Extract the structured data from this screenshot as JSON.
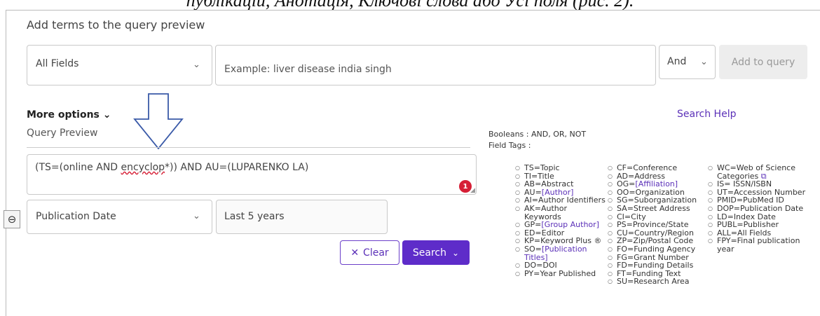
{
  "caption": "публікацій, Анотація, Ключові слова або Усі поля (рис. 2).",
  "header": {
    "title": "Add terms to the query preview"
  },
  "search_row": {
    "field_select": "All Fields",
    "input_placeholder": "Example: liver disease india singh",
    "operator_select": "And",
    "add_button": "Add to query"
  },
  "more_options": "More options",
  "query_preview": {
    "label": "Query Preview",
    "query_parts": [
      "(TS=(online AND ",
      "encyclop",
      "*)) AND AU=(LUPARENKO LA)"
    ],
    "badge_count": "1"
  },
  "filter_row": {
    "field": "Publication Date",
    "value": "Last 5 years"
  },
  "actions": {
    "clear": "Clear",
    "search": "Search"
  },
  "help_link": "Search Help",
  "booleans_text": "Booleans : AND, OR, NOT",
  "field_tags_label": "Field Tags :",
  "tags": {
    "col1": [
      {
        "text": "TS=Topic"
      },
      {
        "text": "TI=Title"
      },
      {
        "text": "AB=Abstract"
      },
      {
        "pre": "AU=",
        "link": "[Author]"
      },
      {
        "text": "AI=Author Identifiers"
      },
      {
        "text": "AK=Author Keywords"
      },
      {
        "pre": "GP=",
        "link": "[Group Author]"
      },
      {
        "text": "ED=Editor"
      },
      {
        "text": "KP=Keyword Plus ®"
      },
      {
        "pre": "SO=",
        "link": "[Publication Titles]"
      },
      {
        "text": "DO=DOI"
      },
      {
        "text": "PY=Year Published"
      }
    ],
    "col2": [
      {
        "text": "CF=Conference"
      },
      {
        "text": "AD=Address"
      },
      {
        "pre": "OG=",
        "link": "[Affiliation]"
      },
      {
        "text": "OO=Organization"
      },
      {
        "text": "SG=Suborganization"
      },
      {
        "text": "SA=Street Address"
      },
      {
        "text": "CI=City"
      },
      {
        "text": "PS=Province/State"
      },
      {
        "text": "CU=Country/Region"
      },
      {
        "text": "ZP=Zip/Postal Code"
      },
      {
        "text": "FO=Funding Agency"
      },
      {
        "text": "FG=Grant Number"
      },
      {
        "text": "FD=Funding Details"
      },
      {
        "text": "FT=Funding Text"
      },
      {
        "text": "SU=Research Area"
      }
    ],
    "col3": [
      {
        "text": "WC=Web of Science Categories",
        "ext": true
      },
      {
        "text": "IS= ISSN/ISBN"
      },
      {
        "text": "UT=Accession Number"
      },
      {
        "text": "PMID=PubMed ID"
      },
      {
        "text": "DOP=Publication Date"
      },
      {
        "text": "LD=Index Date"
      },
      {
        "text": "PUBL=Publisher"
      },
      {
        "text": "ALL=All Fields"
      },
      {
        "text": "FPY=Final publication year"
      }
    ]
  },
  "colors": {
    "accent": "#5e2cc9",
    "badge": "#d61f36",
    "arrow": "#3a5aa8"
  }
}
